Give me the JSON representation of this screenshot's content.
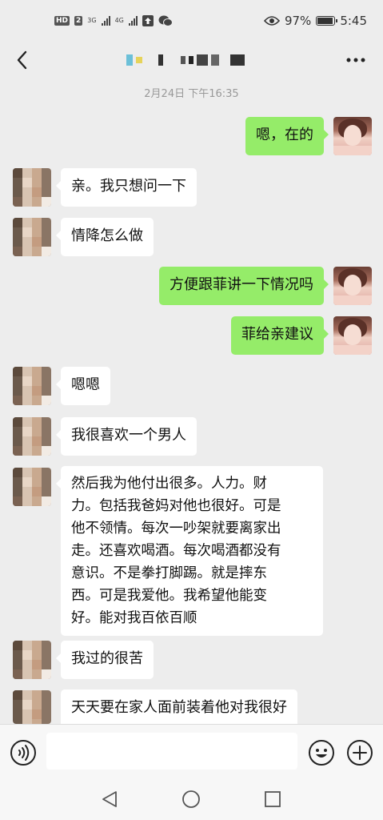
{
  "status_bar": {
    "left_badge": "HD",
    "left_badge2": "2",
    "network1": "3G",
    "network2": "4G",
    "battery_percent": "97%",
    "time": "5:45",
    "battery_level": 0.97
  },
  "header": {
    "timestamp": "2月24日 下午16:35"
  },
  "messages": [
    {
      "side": "out",
      "text": "嗯，在的"
    },
    {
      "side": "in",
      "text": "亲。我只想问一下"
    },
    {
      "side": "in",
      "text": "情降怎么做"
    },
    {
      "side": "out",
      "text": "方便跟菲讲一下情况吗"
    },
    {
      "side": "out",
      "text": "菲给亲建议"
    },
    {
      "side": "in",
      "text": "嗯嗯"
    },
    {
      "side": "in",
      "text": "我很喜欢一个男人"
    },
    {
      "side": "in",
      "lines": [
        "然后我为他付出很多。人力。财",
        "力。包括我爸妈对他也很好。可是",
        "他不领情。每次一吵架就要离家出",
        "走。还喜欢喝酒。每次喝酒都没有",
        "意识。不是拳打脚踢。就是摔东",
        "西。可是我爱他。我希望他能变",
        "好。能对我百依百顺"
      ]
    },
    {
      "side": "in",
      "text": "我过的很苦"
    },
    {
      "side": "in",
      "text": "天天要在家人面前装着他对我很好"
    }
  ],
  "input": {
    "value": "",
    "placeholder": ""
  },
  "colors": {
    "outgoing_bubble": "#95ec69",
    "incoming_bubble": "#ffffff",
    "background": "#ededed"
  }
}
